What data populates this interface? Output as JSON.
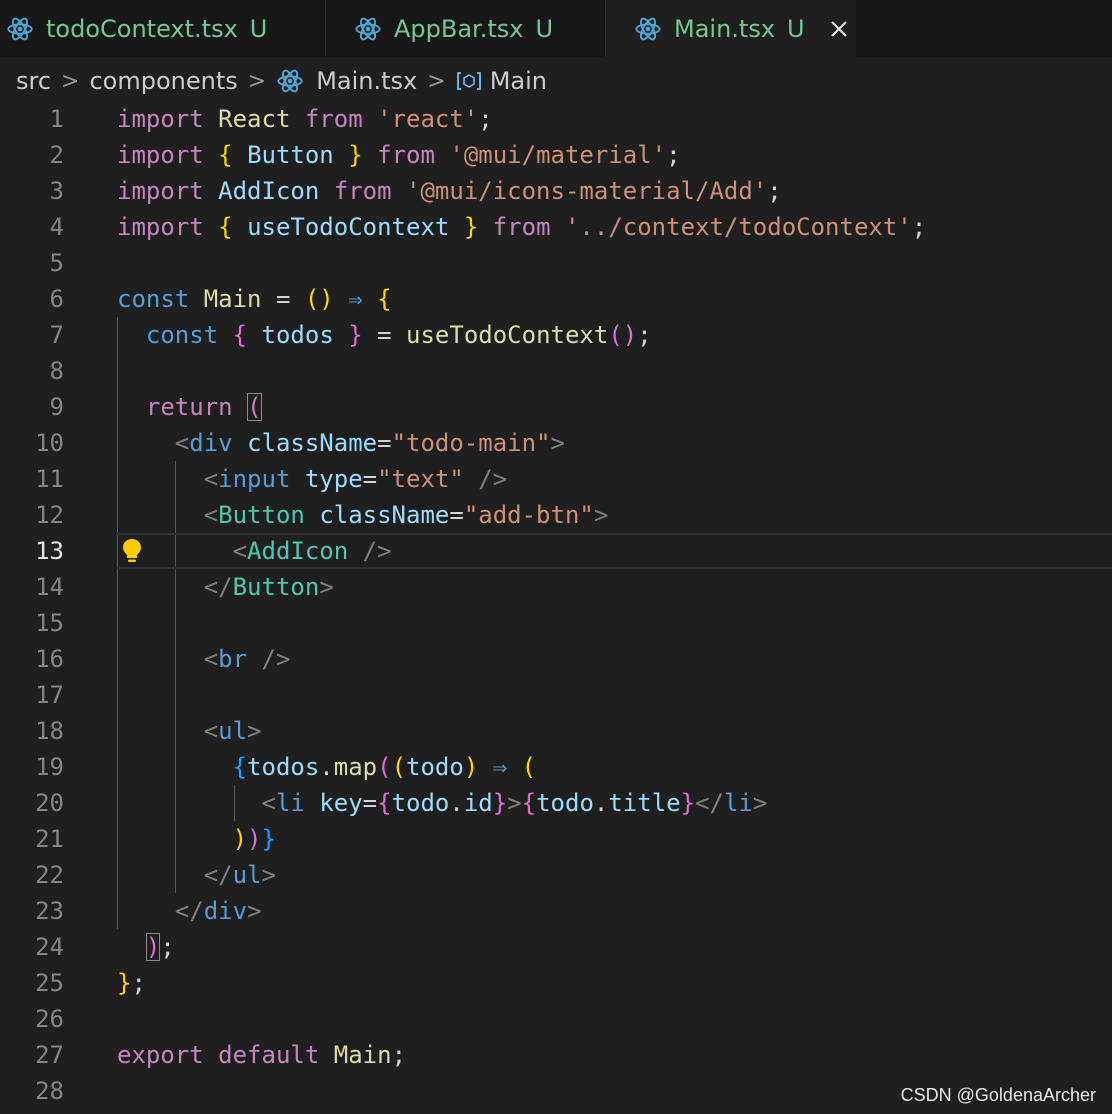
{
  "tabs": [
    {
      "label": "todoContext.tsx",
      "status": "U"
    },
    {
      "label": "AppBar.tsx",
      "status": "U"
    },
    {
      "label": "Main.tsx",
      "status": "U",
      "active": true
    }
  ],
  "breadcrumb": {
    "items": [
      "src",
      "components",
      "Main.tsx",
      "Main"
    ]
  },
  "editor": {
    "current_line": 13,
    "lines": [
      [
        [
          "k",
          "import"
        ],
        [
          "p",
          " "
        ],
        [
          "fn",
          "React"
        ],
        [
          "p",
          " "
        ],
        [
          "k",
          "from"
        ],
        [
          "p",
          " "
        ],
        [
          "s",
          "'react'"
        ],
        [
          "p",
          ";"
        ]
      ],
      [
        [
          "k",
          "import"
        ],
        [
          "p",
          " "
        ],
        [
          "b1",
          "{"
        ],
        [
          "p",
          " "
        ],
        [
          "v",
          "Button"
        ],
        [
          "p",
          " "
        ],
        [
          "b1",
          "}"
        ],
        [
          "p",
          " "
        ],
        [
          "k",
          "from"
        ],
        [
          "p",
          " "
        ],
        [
          "s",
          "'@mui/material'"
        ],
        [
          "p",
          ";"
        ]
      ],
      [
        [
          "k",
          "import"
        ],
        [
          "p",
          " "
        ],
        [
          "v",
          "AddIcon"
        ],
        [
          "p",
          " "
        ],
        [
          "k",
          "from"
        ],
        [
          "p",
          " "
        ],
        [
          "s",
          "'@mui/icons-material/Add'"
        ],
        [
          "p",
          ";"
        ]
      ],
      [
        [
          "k",
          "import"
        ],
        [
          "p",
          " "
        ],
        [
          "b1",
          "{"
        ],
        [
          "p",
          " "
        ],
        [
          "v",
          "useTodoContext"
        ],
        [
          "p",
          " "
        ],
        [
          "b1",
          "}"
        ],
        [
          "p",
          " "
        ],
        [
          "k",
          "from"
        ],
        [
          "p",
          " "
        ],
        [
          "s",
          "'../context/todoContext'"
        ],
        [
          "p",
          ";"
        ]
      ],
      [],
      [
        [
          "kb",
          "const"
        ],
        [
          "p",
          " "
        ],
        [
          "fn",
          "Main"
        ],
        [
          "p",
          " = "
        ],
        [
          "b1",
          "()"
        ],
        [
          "p",
          " "
        ],
        [
          "kb",
          "⇒"
        ],
        [
          "p",
          " "
        ],
        [
          "b1",
          "{"
        ]
      ],
      [
        [
          "p",
          "  "
        ],
        [
          "kb",
          "const"
        ],
        [
          "p",
          " "
        ],
        [
          "b2",
          "{"
        ],
        [
          "p",
          " "
        ],
        [
          "v",
          "todos"
        ],
        [
          "p",
          " "
        ],
        [
          "b2",
          "}"
        ],
        [
          "p",
          " = "
        ],
        [
          "fn",
          "useTodoContext"
        ],
        [
          "b2",
          "()"
        ],
        [
          "p",
          ";"
        ]
      ],
      [],
      [
        [
          "p",
          "  "
        ],
        [
          "k",
          "return"
        ],
        [
          "p",
          " "
        ],
        [
          "b2box",
          "("
        ]
      ],
      [
        [
          "p",
          "    "
        ],
        [
          "br",
          "<"
        ],
        [
          "tb",
          "div"
        ],
        [
          "p",
          " "
        ],
        [
          "v",
          "className"
        ],
        [
          "p",
          "="
        ],
        [
          "s",
          "\"todo-main\""
        ],
        [
          "br",
          ">"
        ]
      ],
      [
        [
          "p",
          "      "
        ],
        [
          "br",
          "<"
        ],
        [
          "tb",
          "input"
        ],
        [
          "p",
          " "
        ],
        [
          "v",
          "type"
        ],
        [
          "p",
          "="
        ],
        [
          "s",
          "\"text\""
        ],
        [
          "p",
          " "
        ],
        [
          "br",
          "/>"
        ]
      ],
      [
        [
          "p",
          "      "
        ],
        [
          "br",
          "<"
        ],
        [
          "tg",
          "Button"
        ],
        [
          "p",
          " "
        ],
        [
          "v",
          "className"
        ],
        [
          "p",
          "="
        ],
        [
          "s",
          "\"add-btn\""
        ],
        [
          "br",
          ">"
        ]
      ],
      [
        [
          "p",
          "        "
        ],
        [
          "br",
          "<"
        ],
        [
          "tg",
          "AddIcon"
        ],
        [
          "p",
          " "
        ],
        [
          "br",
          "/>"
        ]
      ],
      [
        [
          "p",
          "      "
        ],
        [
          "br",
          "</"
        ],
        [
          "tg",
          "Button"
        ],
        [
          "br",
          ">"
        ]
      ],
      [],
      [
        [
          "p",
          "      "
        ],
        [
          "br",
          "<"
        ],
        [
          "tb",
          "br"
        ],
        [
          "p",
          " "
        ],
        [
          "br",
          "/>"
        ]
      ],
      [],
      [
        [
          "p",
          "      "
        ],
        [
          "br",
          "<"
        ],
        [
          "tb",
          "ul"
        ],
        [
          "br",
          ">"
        ]
      ],
      [
        [
          "p",
          "        "
        ],
        [
          "b3",
          "{"
        ],
        [
          "v",
          "todos"
        ],
        [
          "p",
          "."
        ],
        [
          "fn",
          "map"
        ],
        [
          "b2",
          "("
        ],
        [
          "b1",
          "("
        ],
        [
          "v",
          "todo"
        ],
        [
          "b1",
          ")"
        ],
        [
          "p",
          " "
        ],
        [
          "kb",
          "⇒"
        ],
        [
          "p",
          " "
        ],
        [
          "b1",
          "("
        ]
      ],
      [
        [
          "p",
          "          "
        ],
        [
          "br",
          "<"
        ],
        [
          "tb",
          "li"
        ],
        [
          "p",
          " "
        ],
        [
          "v",
          "key"
        ],
        [
          "p",
          "="
        ],
        [
          "b2",
          "{"
        ],
        [
          "v",
          "todo"
        ],
        [
          "p",
          "."
        ],
        [
          "v",
          "id"
        ],
        [
          "b2",
          "}"
        ],
        [
          "br",
          ">"
        ],
        [
          "b2",
          "{"
        ],
        [
          "v",
          "todo"
        ],
        [
          "p",
          "."
        ],
        [
          "v",
          "title"
        ],
        [
          "b2",
          "}"
        ],
        [
          "br",
          "</"
        ],
        [
          "tb",
          "li"
        ],
        [
          "br",
          ">"
        ]
      ],
      [
        [
          "p",
          "        "
        ],
        [
          "b1",
          ")"
        ],
        [
          "b2",
          ")"
        ],
        [
          "b3",
          "}"
        ]
      ],
      [
        [
          "p",
          "      "
        ],
        [
          "br",
          "</"
        ],
        [
          "tb",
          "ul"
        ],
        [
          "br",
          ">"
        ]
      ],
      [
        [
          "p",
          "    "
        ],
        [
          "br",
          "</"
        ],
        [
          "tb",
          "div"
        ],
        [
          "br",
          ">"
        ]
      ],
      [
        [
          "p",
          "  "
        ],
        [
          "b2box",
          ")"
        ],
        [
          "p",
          ";"
        ]
      ],
      [
        [
          "b1",
          "}"
        ],
        [
          "p",
          ";"
        ]
      ],
      [],
      [
        [
          "k",
          "export"
        ],
        [
          "p",
          " "
        ],
        [
          "k",
          "default"
        ],
        [
          "p",
          " "
        ],
        [
          "fn",
          "Main"
        ],
        [
          "p",
          ";"
        ]
      ],
      []
    ]
  },
  "watermark": "CSDN @GoldenaArcher",
  "colors": {
    "background": "#1f1f1f",
    "tab_inactive": "#181818",
    "modified": "#73c991",
    "react_icon": "#4fa8d8"
  }
}
